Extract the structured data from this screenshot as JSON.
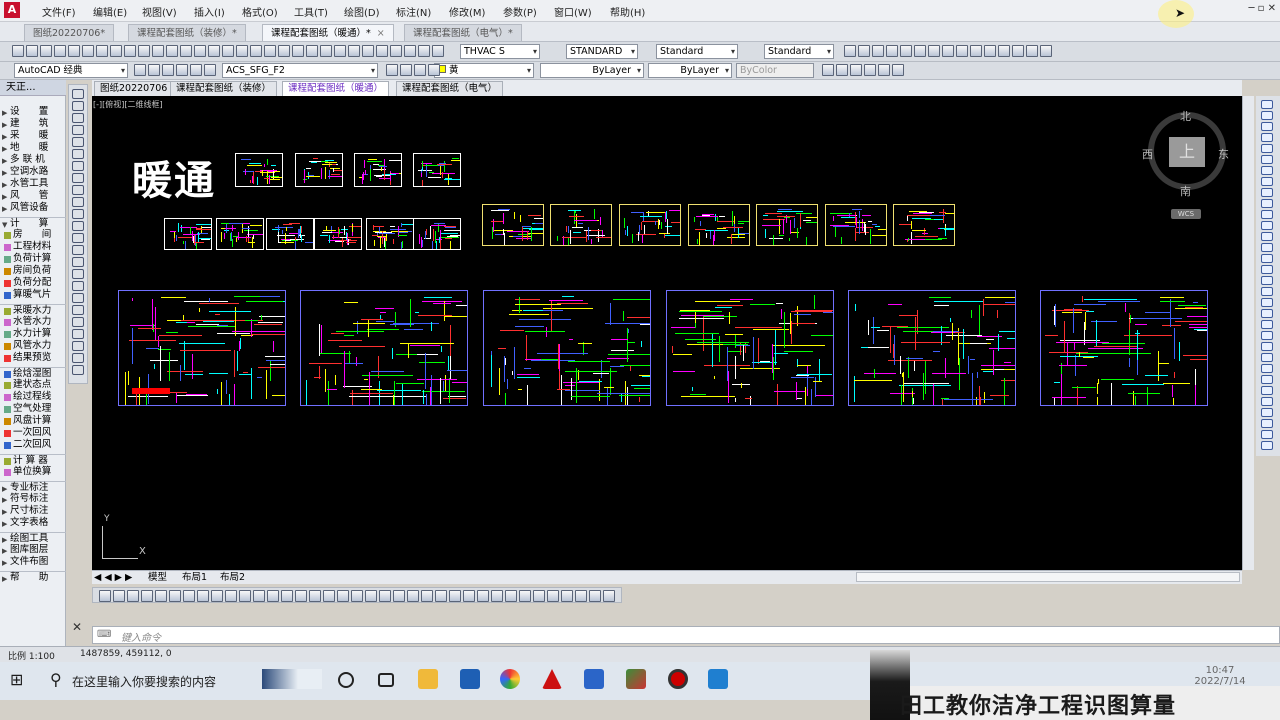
{
  "menu": [
    "文件(F)",
    "编辑(E)",
    "视图(V)",
    "插入(I)",
    "格式(O)",
    "工具(T)",
    "绘图(D)",
    "标注(N)",
    "修改(M)",
    "参数(P)",
    "窗口(W)",
    "帮助(H)"
  ],
  "file_tabs": [
    {
      "label": "图纸20220706*",
      "active": false
    },
    {
      "label": "课程配套图纸（装修）*",
      "active": false
    },
    {
      "label": "课程配套图纸（暖通）*",
      "active": true
    },
    {
      "label": "课程配套图纸（电气）*",
      "active": false
    }
  ],
  "toolbar": {
    "text_style": "THVAC S",
    "dim_style": "STANDARD",
    "table_style": "Standard",
    "multileader_style": "Standard",
    "workspace": "AutoCAD 经典",
    "layer": "ACS_SFG_F2",
    "color": "黄",
    "linetype": "ByLayer",
    "lineweight": "ByLayer",
    "plotstyle": "ByColor"
  },
  "left_panel": {
    "title": "天正...",
    "items": [
      {
        "label": "设　　置",
        "kind": "arrow",
        "sep": false
      },
      {
        "label": "建　　筑",
        "kind": "arrow",
        "sep": false
      },
      {
        "label": "采　　暖",
        "kind": "arrow",
        "sep": false
      },
      {
        "label": "地　　暖",
        "kind": "arrow",
        "sep": false
      },
      {
        "label": "多 联 机",
        "kind": "arrow",
        "sep": false
      },
      {
        "label": "空调水路",
        "kind": "arrow",
        "sep": false
      },
      {
        "label": "水管工具",
        "kind": "arrow",
        "sep": false
      },
      {
        "label": "风　　管",
        "kind": "arrow",
        "sep": false
      },
      {
        "label": "风管设备",
        "kind": "arrow",
        "sep": false
      },
      {
        "label": "计　　算",
        "kind": "down",
        "sep": true
      },
      {
        "label": "房　　间",
        "kind": "icon",
        "sep": false
      },
      {
        "label": "工程材料",
        "kind": "icon",
        "sep": false
      },
      {
        "label": "负荷计算",
        "kind": "icon",
        "sep": false
      },
      {
        "label": "房间负荷",
        "kind": "icon",
        "sep": false
      },
      {
        "label": "负荷分配",
        "kind": "icon",
        "sep": false
      },
      {
        "label": "算暖气片",
        "kind": "icon",
        "sep": false
      },
      {
        "label": "采暖水力",
        "kind": "icon",
        "sep": true
      },
      {
        "label": "水管水力",
        "kind": "icon",
        "sep": false
      },
      {
        "label": "水力计算",
        "kind": "icon",
        "sep": false
      },
      {
        "label": "风管水力",
        "kind": "icon",
        "sep": false
      },
      {
        "label": "结果预览",
        "kind": "icon",
        "sep": false
      },
      {
        "label": "绘焓湿图",
        "kind": "icon",
        "sep": true
      },
      {
        "label": "建状态点",
        "kind": "icon",
        "sep": false
      },
      {
        "label": "绘过程线",
        "kind": "icon",
        "sep": false
      },
      {
        "label": "空气处理",
        "kind": "icon",
        "sep": false
      },
      {
        "label": "风盘计算",
        "kind": "icon",
        "sep": false
      },
      {
        "label": "一次回风",
        "kind": "icon",
        "sep": false
      },
      {
        "label": "二次回风",
        "kind": "icon",
        "sep": false
      },
      {
        "label": "计 算 器",
        "kind": "icon",
        "sep": true
      },
      {
        "label": "单位换算",
        "kind": "icon",
        "sep": false
      },
      {
        "label": "专业标注",
        "kind": "arrow",
        "sep": true
      },
      {
        "label": "符号标注",
        "kind": "arrow",
        "sep": false
      },
      {
        "label": "尺寸标注",
        "kind": "arrow",
        "sep": false
      },
      {
        "label": "文字表格",
        "kind": "arrow",
        "sep": false
      },
      {
        "label": "绘图工具",
        "kind": "arrow",
        "sep": true
      },
      {
        "label": "图库图层",
        "kind": "arrow",
        "sep": false
      },
      {
        "label": "文件布图",
        "kind": "arrow",
        "sep": false
      },
      {
        "label": "帮　　助",
        "kind": "arrow",
        "sep": true
      }
    ]
  },
  "canvas_tabs": [
    {
      "label": "图纸20220706",
      "active": false
    },
    {
      "label": "课程配套图纸（装修）",
      "active": false
    },
    {
      "label": "课程配套图纸（暖通）",
      "active": true
    },
    {
      "label": "课程配套图纸（电气）",
      "active": false
    }
  ],
  "canvas": {
    "viewport_label": "[-][俯视][二维线框]",
    "heading": "暖通",
    "compass": {
      "north": "北",
      "south": "南",
      "east": "东",
      "west": "西",
      "top": "上",
      "wcs": "WCS"
    },
    "ucs": {
      "x": "X",
      "y": "Y"
    }
  },
  "layout_tabs": [
    "模型",
    "布局1",
    "布局2"
  ],
  "command": {
    "placeholder": "键入命令"
  },
  "status": {
    "scale": "比例 1:100",
    "coords": "1487859, 459112, 0"
  },
  "taskbar": {
    "search_placeholder": "在这里输入你要搜索的内容",
    "time": "10:47",
    "date": "2022/7/14"
  },
  "banner": {
    "text": "田工教你洁净工程识图算量"
  },
  "colors": {
    "canvas_bg": "#000000",
    "accent_purple": "#6a2bc2"
  }
}
